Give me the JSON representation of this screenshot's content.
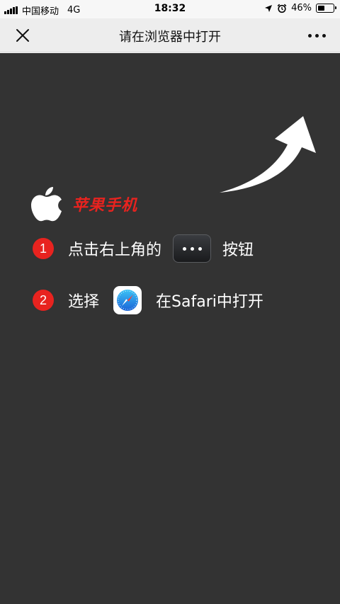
{
  "status_bar": {
    "carrier": "中国移动",
    "network": "4G",
    "time": "18:32",
    "battery_percent": "46%",
    "battery_level": 0.46,
    "icons": [
      "signal-icon",
      "location-icon",
      "alarm-icon",
      "battery-icon"
    ]
  },
  "nav": {
    "title": "请在浏览器中打开",
    "close_icon": "close-icon",
    "more_icon": "more-icon"
  },
  "overlay": {
    "brand": "苹果手机",
    "brand_icon": "apple-logo",
    "steps": [
      {
        "number": "1",
        "before": "点击右上角的",
        "icon": "more-dots-icon",
        "after": "按钮"
      },
      {
        "number": "2",
        "before": "选择",
        "icon": "safari-icon",
        "after": "在Safari中打开"
      }
    ],
    "arrow_icon": "curved-arrow-icon"
  },
  "colors": {
    "overlay_bg": "#333333",
    "accent_red": "#e8231f",
    "nav_bg": "#ededed",
    "text_white": "#ffffff"
  }
}
